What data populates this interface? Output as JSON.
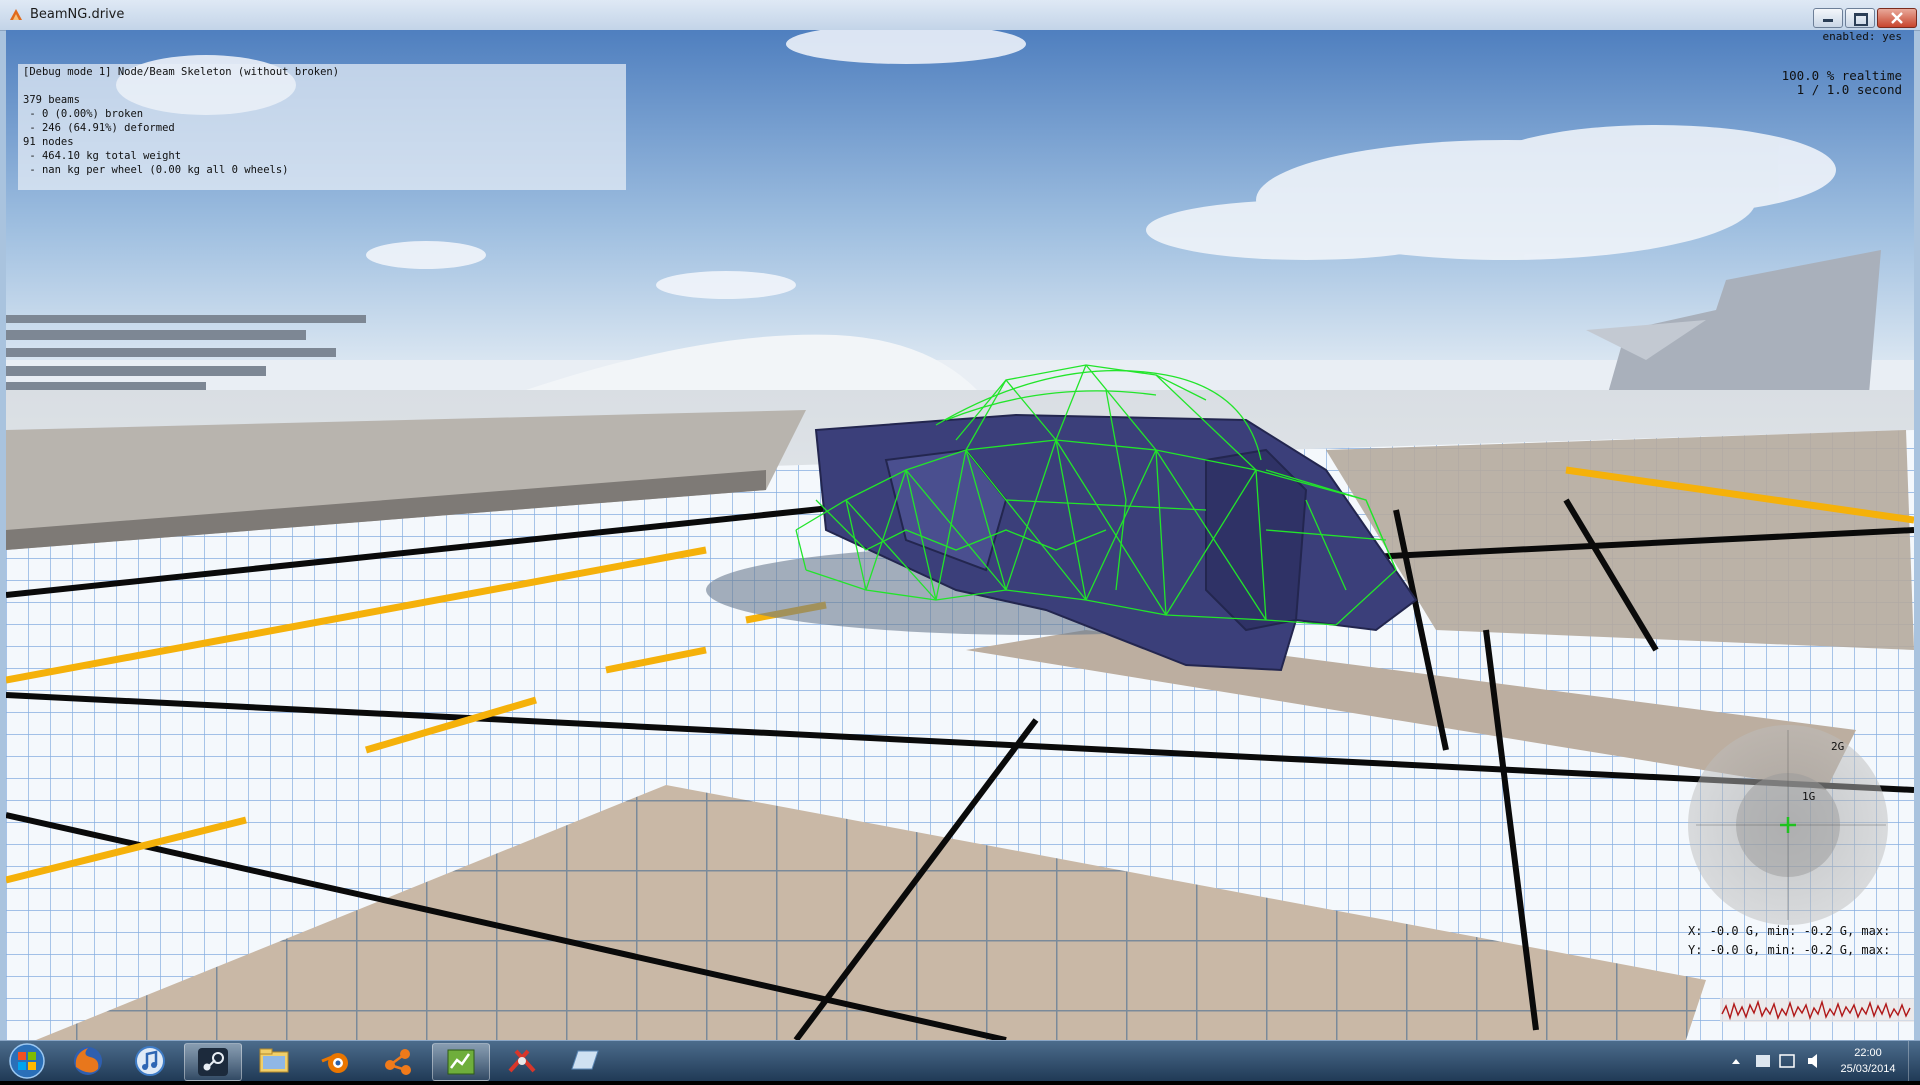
{
  "window": {
    "title": "BeamNG.drive",
    "icon": "beamng-icon"
  },
  "debug": {
    "lines": [
      "[Debug mode 1] Node/Beam Skeleton (without broken)",
      "",
      "379 beams",
      " - 0 (0.00%) broken",
      " - 246 (64.91%) deformed",
      "91 nodes",
      " - 464.10 kg total weight",
      " - nan kg per wheel (0.00 kg all 0 wheels)"
    ]
  },
  "hud": {
    "enabled": "enabled: yes",
    "realtime": "100.0 % realtime",
    "second": "1 / 1.0 second"
  },
  "gforce": {
    "label_2g": "2G",
    "label_1g": "1G",
    "x_line": "X: -0.0 G, min: -0.2 G, max:",
    "y_line": "Y: -0.0 G, min: -0.2 G, max:"
  },
  "taskbar": {
    "apps": [
      "start-orb",
      "firefox-icon",
      "itunes-icon",
      "steam-icon",
      "file-explorer-icon",
      "blender-icon",
      "share-icon",
      "spreadsheet-icon",
      "tool-icon",
      "notepad-icon"
    ],
    "clock_time": "22:00",
    "clock_date": "25/03/2014"
  },
  "colors": {
    "wireframe": "#22e52a",
    "car_body": "#3b3f7a",
    "stripe": "#f5b10a"
  }
}
